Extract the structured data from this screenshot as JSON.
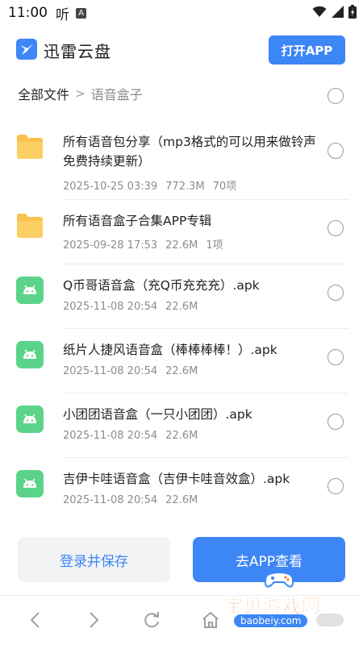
{
  "status_bar": {
    "time": "11:00",
    "notif_text": "听",
    "notif_badge": "A"
  },
  "header": {
    "app_name": "迅雷云盘",
    "open_app_label": "打开APP"
  },
  "breadcrumb": {
    "root": "全部文件",
    "separator": ">",
    "current": "语音盒子"
  },
  "files": [
    {
      "type": "folder",
      "name": "所有语音包分享（mp3格式的可以用来做铃声 免费持续更新）",
      "date": "2025-10-25 03:39",
      "size": "772.3M",
      "count": "70项"
    },
    {
      "type": "folder",
      "name": "所有语音盒子合集APP专辑",
      "date": "2025-09-28 17:53",
      "size": "22.6M",
      "count": "1项"
    },
    {
      "type": "apk",
      "name": "Q币哥语音盒（充Q币充充充）.apk",
      "date": "2025-11-08 20:54",
      "size": "22.6M"
    },
    {
      "type": "apk",
      "name": "纸片人捷风语音盒（棒棒棒棒！）.apk",
      "date": "2025-11-08 20:54",
      "size": "22.6M"
    },
    {
      "type": "apk",
      "name": "小团团语音盒（一只小团团）.apk",
      "date": "2025-11-08 20:54",
      "size": "22.6M"
    },
    {
      "type": "apk",
      "name": "吉伊卡哇语音盒（吉伊卡哇音效盒）.apk",
      "date": "2025-11-08 20:54",
      "size": "22.6M"
    }
  ],
  "actions": {
    "login_save_label": "登录并保存",
    "view_in_app_label": "去APP查看"
  },
  "watermark": {
    "title": "宝贝游戏网",
    "url": "baobeiy.com"
  },
  "colors": {
    "accent": "#3d86f5",
    "folder": "#f9c24f",
    "apk": "#5bd48a"
  }
}
